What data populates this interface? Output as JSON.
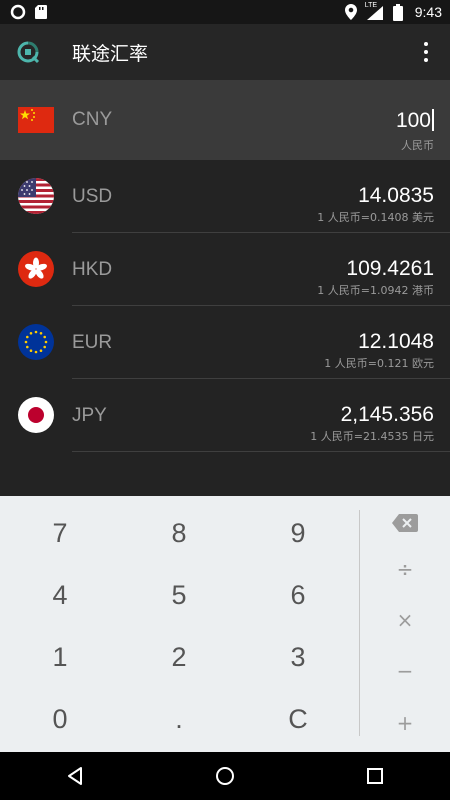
{
  "status_bar": {
    "time": "9:43",
    "network_label": "LTE"
  },
  "app_bar": {
    "title": "联途汇率"
  },
  "base_currency": {
    "code": "CNY",
    "value": "100",
    "name": "人民币"
  },
  "currencies": [
    {
      "code": "USD",
      "amount": "14.0835",
      "rate": "1 人民币=0.1408 美元"
    },
    {
      "code": "HKD",
      "amount": "109.4261",
      "rate": "1 人民币=1.0942 港币"
    },
    {
      "code": "EUR",
      "amount": "12.1048",
      "rate": "1 人民币=0.121 欧元"
    },
    {
      "code": "JPY",
      "amount": "2,145.356",
      "rate": "1 人民币=21.4535 日元"
    }
  ],
  "keypad": {
    "keys": [
      "7",
      "8",
      "9",
      "4",
      "5",
      "6",
      "1",
      "2",
      "3",
      "0",
      ".",
      "C"
    ],
    "ops": [
      "÷",
      "×",
      "−",
      "+"
    ]
  },
  "colors": {
    "accent": "#4db6ac",
    "background": "#232323",
    "selected_row": "#3a3a3a",
    "keypad_bg": "#eceff1"
  }
}
